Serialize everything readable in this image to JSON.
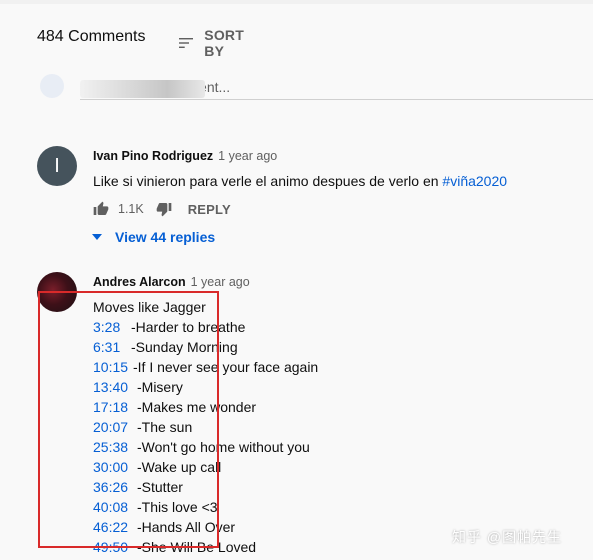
{
  "header": {
    "comment_count": "484 Comments",
    "sort_label": "SORT BY"
  },
  "add_comment": {
    "placeholder": "Add a public comment..."
  },
  "comments": [
    {
      "author": "Ivan Pino Rodriguez",
      "time": "1 year ago",
      "avatar_letter": "I",
      "text_before_tag": "Like si vinieron para verle el animo despues de verlo en ",
      "hashtag": "#viña2020",
      "likes": "1.1K",
      "reply_label": "REPLY",
      "view_replies": "View 44 replies"
    },
    {
      "author": "Andres Alarcon",
      "time": "1 year ago",
      "first_line": "Moves like Jagger",
      "tracklist": [
        {
          "time": "3:28",
          "title": "-Harder to breathe"
        },
        {
          "time": "6:31",
          "title": "-Sunday Morning"
        },
        {
          "time": "10:15",
          "title": "-If I never see your face again"
        },
        {
          "time": "13:40",
          "title": "-Misery"
        },
        {
          "time": "17:18",
          "title": "-Makes me wonder"
        },
        {
          "time": "20:07",
          "title": "-The sun"
        },
        {
          "time": "25:38",
          "title": "-Won't go home without you"
        },
        {
          "time": "30:00",
          "title": "-Wake up call"
        },
        {
          "time": "36:26",
          "title": "-Stutter"
        },
        {
          "time": "40:08",
          "title": "-This love <3"
        },
        {
          "time": "46:22",
          "title": "-Hands All Over"
        },
        {
          "time": "49:50",
          "title": "-She Will Be Loved"
        }
      ]
    }
  ],
  "watermark": "知乎 @图帕先生",
  "colors": {
    "link_blue": "#065fd4",
    "highlight_red": "#d92a2a",
    "avatar_gray": "#45535c"
  },
  "icons": {
    "sort": "sort-icon",
    "like": "thumbs-up-icon",
    "dislike": "thumbs-down-icon",
    "expand": "caret-down-icon"
  }
}
